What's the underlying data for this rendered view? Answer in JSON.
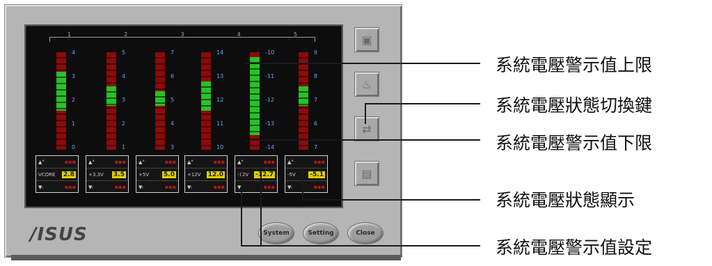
{
  "app": {
    "logo": "/ISUS"
  },
  "scale_labels": [
    "1",
    "2",
    "3",
    "4",
    "5"
  ],
  "meters": [
    {
      "top": "4",
      "v1": "3",
      "v2": "2",
      "v3": "1",
      "bottom": "0",
      "green_from": 0.2,
      "green_to": 0.6
    },
    {
      "top": "5",
      "v1": "4",
      "v2": "3",
      "v3": "2",
      "bottom": "1",
      "green_from": 0.35,
      "green_to": 0.55
    },
    {
      "top": "7",
      "v1": "6",
      "v2": "5",
      "v3": "4",
      "bottom": "3",
      "green_from": 0.4,
      "green_to": 0.55
    },
    {
      "top": "14",
      "v1": "13",
      "v2": "12",
      "v3": "11",
      "bottom": "10",
      "green_from": 0.3,
      "green_to": 0.6
    },
    {
      "top": "-10",
      "v1": "-11",
      "v2": "-12",
      "v3": "-13",
      "bottom": "-14",
      "green_from": 0.05,
      "green_to": 0.85
    },
    {
      "top": "9",
      "v1": "8",
      "v2": "7",
      "v3": "6",
      "bottom": "7",
      "green_from": 0.35,
      "green_to": 0.55
    }
  ],
  "value_boxes": [
    {
      "name": "VCORE",
      "value": "2.8"
    },
    {
      "name": "+3.3V",
      "value": "3.5"
    },
    {
      "name": "+5V",
      "value": "5.0"
    },
    {
      "name": "+12V",
      "value": "12.0"
    },
    {
      "name": "-12V",
      "value": "-12.7"
    },
    {
      "name": "-5V",
      "value": "-5.1"
    }
  ],
  "buttons": {
    "system": "System",
    "setting": "Setting",
    "close": "Close"
  },
  "callouts": [
    "系統電壓警示值上限",
    "系統電壓狀態切換鍵",
    "系統電壓警示值下限",
    "系統電壓狀態顯示",
    "系統電壓警示值設定"
  ]
}
